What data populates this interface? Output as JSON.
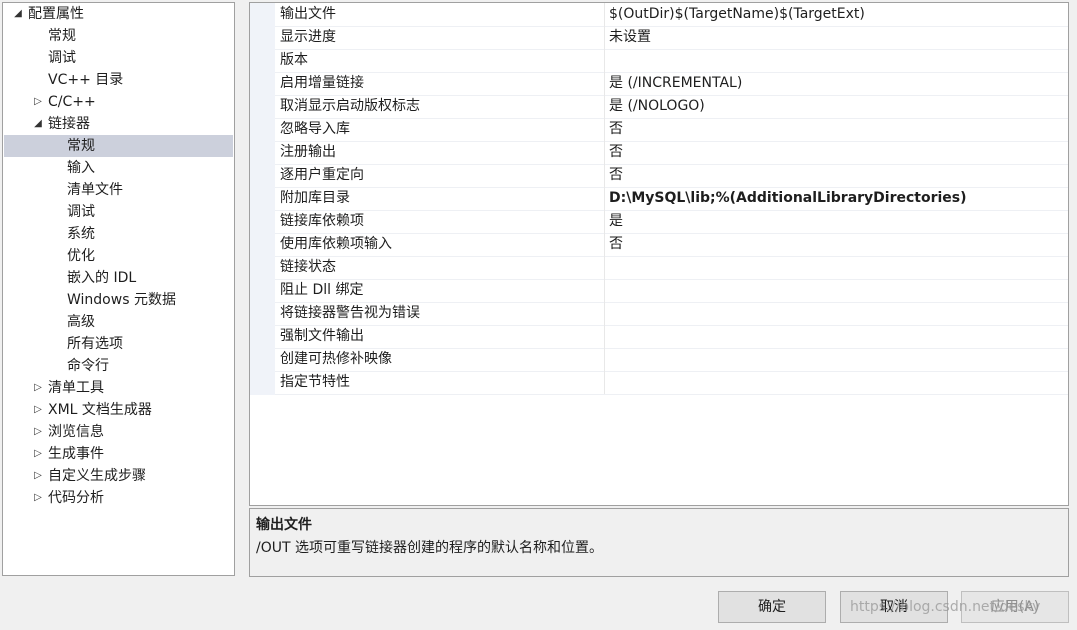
{
  "tree": {
    "items": [
      {
        "label": "配置属性",
        "toggle": "expanded"
      },
      {
        "label": "常规",
        "toggle": "none"
      },
      {
        "label": "调试",
        "toggle": "none"
      },
      {
        "label": "VC++ 目录",
        "toggle": "none"
      },
      {
        "label": "C/C++",
        "toggle": "collapsed"
      },
      {
        "label": "链接器",
        "toggle": "expanded"
      },
      {
        "label": "常规",
        "toggle": "none",
        "selected": true
      },
      {
        "label": "输入",
        "toggle": "none"
      },
      {
        "label": "清单文件",
        "toggle": "none"
      },
      {
        "label": "调试",
        "toggle": "none"
      },
      {
        "label": "系统",
        "toggle": "none"
      },
      {
        "label": "优化",
        "toggle": "none"
      },
      {
        "label": "嵌入的 IDL",
        "toggle": "none"
      },
      {
        "label": "Windows 元数据",
        "toggle": "none"
      },
      {
        "label": "高级",
        "toggle": "none"
      },
      {
        "label": "所有选项",
        "toggle": "none"
      },
      {
        "label": "命令行",
        "toggle": "none"
      },
      {
        "label": "清单工具",
        "toggle": "collapsed"
      },
      {
        "label": "XML 文档生成器",
        "toggle": "collapsed"
      },
      {
        "label": "浏览信息",
        "toggle": "collapsed"
      },
      {
        "label": "生成事件",
        "toggle": "collapsed"
      },
      {
        "label": "自定义生成步骤",
        "toggle": "collapsed"
      },
      {
        "label": "代码分析",
        "toggle": "collapsed"
      }
    ]
  },
  "grid": {
    "rows": [
      {
        "name": "输出文件",
        "value": "$(OutDir)$(TargetName)$(TargetExt)",
        "bold": false
      },
      {
        "name": "显示进度",
        "value": "未设置",
        "bold": false
      },
      {
        "name": "版本",
        "value": "",
        "bold": false
      },
      {
        "name": "启用增量链接",
        "value": "是 (/INCREMENTAL)",
        "bold": false
      },
      {
        "name": "取消显示启动版权标志",
        "value": "是 (/NOLOGO)",
        "bold": false
      },
      {
        "name": "忽略导入库",
        "value": "否",
        "bold": false
      },
      {
        "name": "注册输出",
        "value": "否",
        "bold": false
      },
      {
        "name": "逐用户重定向",
        "value": "否",
        "bold": false
      },
      {
        "name": "附加库目录",
        "value": "D:\\MySQL\\lib;%(AdditionalLibraryDirectories)",
        "bold": true
      },
      {
        "name": "链接库依赖项",
        "value": "是",
        "bold": false
      },
      {
        "name": "使用库依赖项输入",
        "value": "否",
        "bold": false
      },
      {
        "name": "链接状态",
        "value": "",
        "bold": false
      },
      {
        "name": "阻止 Dll 绑定",
        "value": "",
        "bold": false
      },
      {
        "name": "将链接器警告视为错误",
        "value": "",
        "bold": false
      },
      {
        "name": "强制文件输出",
        "value": "",
        "bold": false
      },
      {
        "name": "创建可热修补映像",
        "value": "",
        "bold": false
      },
      {
        "name": "指定节特性",
        "value": "",
        "bold": false
      }
    ]
  },
  "description": {
    "title": "输出文件",
    "text": "/OUT 选项可重写链接器创建的程序的默认名称和位置。"
  },
  "buttons": {
    "ok": "确定",
    "cancel": "取消",
    "apply": "应用(A)"
  },
  "watermark": "https://blog.csdn.net/desky",
  "icons": {
    "expanded": "expanded-arrow-icon",
    "collapsed": "collapsed-arrow-icon"
  }
}
